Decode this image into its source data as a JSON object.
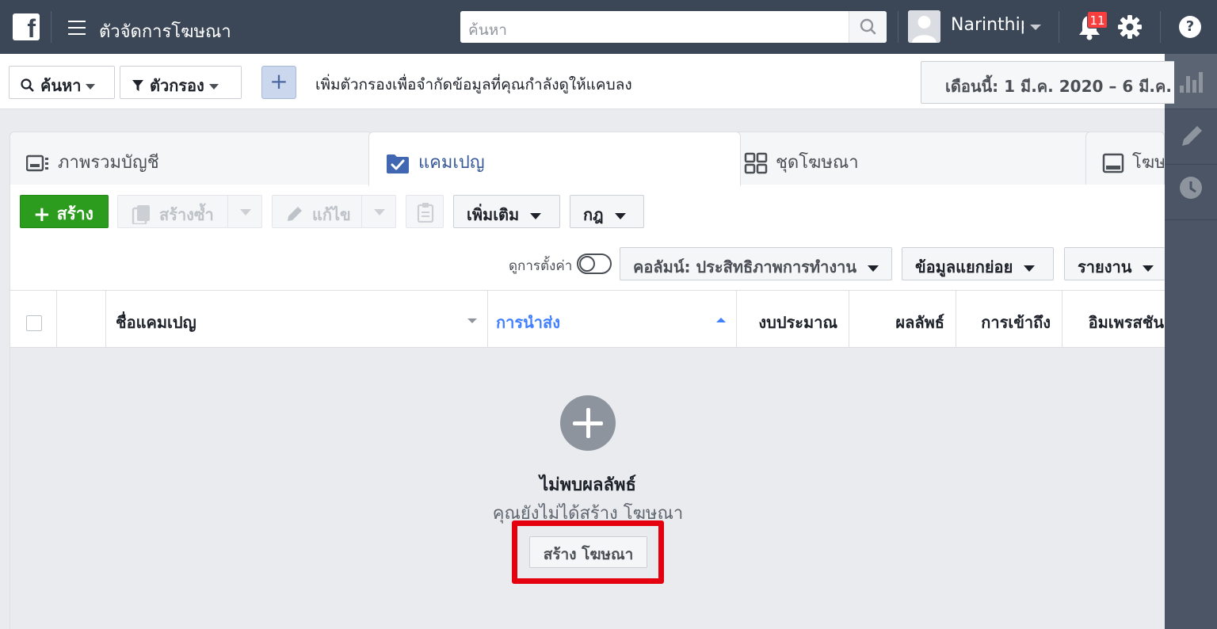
{
  "topbar": {
    "logo_letter": "f",
    "app_title": "ตัวจัดการโฆษณา",
    "search_placeholder": "ค้นหา",
    "user_name": "Narinthip",
    "notification_count": "11"
  },
  "filterbar": {
    "search_label": "ค้นหา",
    "filter_label": "ตัวกรอง",
    "add_filter_symbol": "+",
    "hint": "เพิ่มตัวกรองเพื่อจำกัดข้อมูลที่คุณกำลังดูให้แคบลง",
    "date_range": "เดือนนี้: 1 มี.ค. 2020 – 6 มี.ค."
  },
  "tabs": [
    {
      "label": "ภาพรวมบัญชี",
      "active": false
    },
    {
      "label": "แคมเปญ",
      "active": true
    },
    {
      "label": "ชุดโฆษณา",
      "active": false
    },
    {
      "label": "โฆษ",
      "active": false
    }
  ],
  "actions": {
    "create": "สร้าง",
    "duplicate": "สร้างซ้ำ",
    "edit": "แก้ไข",
    "more": "เพิ่มเติม",
    "rules": "กฎ",
    "view_settings": "ดูการตั้งค่า",
    "columns": "คอลัมน์: ประสิทธิภาพการทำงาน",
    "breakdown": "ข้อมูลแยกย่อย",
    "reports": "รายงาน"
  },
  "table": {
    "headers": [
      "ชื่อแคมเปญ",
      "การนำส่ง",
      "งบประมาณ",
      "ผลลัพธ์",
      "การเข้าถึง",
      "อิมเพรสชัน"
    ]
  },
  "empty_state": {
    "title": "ไม่พบผลลัพธ์",
    "subtitle": "คุณยังไม่ได้สร้าง โฆษณา",
    "button": "สร้าง โฆษณา"
  },
  "colors": {
    "topbar": "#3b4656",
    "create_green": "#2c9c1e",
    "link_blue": "#365899",
    "highlight_red": "#e4000f",
    "badge_red": "#fa3e3e"
  }
}
